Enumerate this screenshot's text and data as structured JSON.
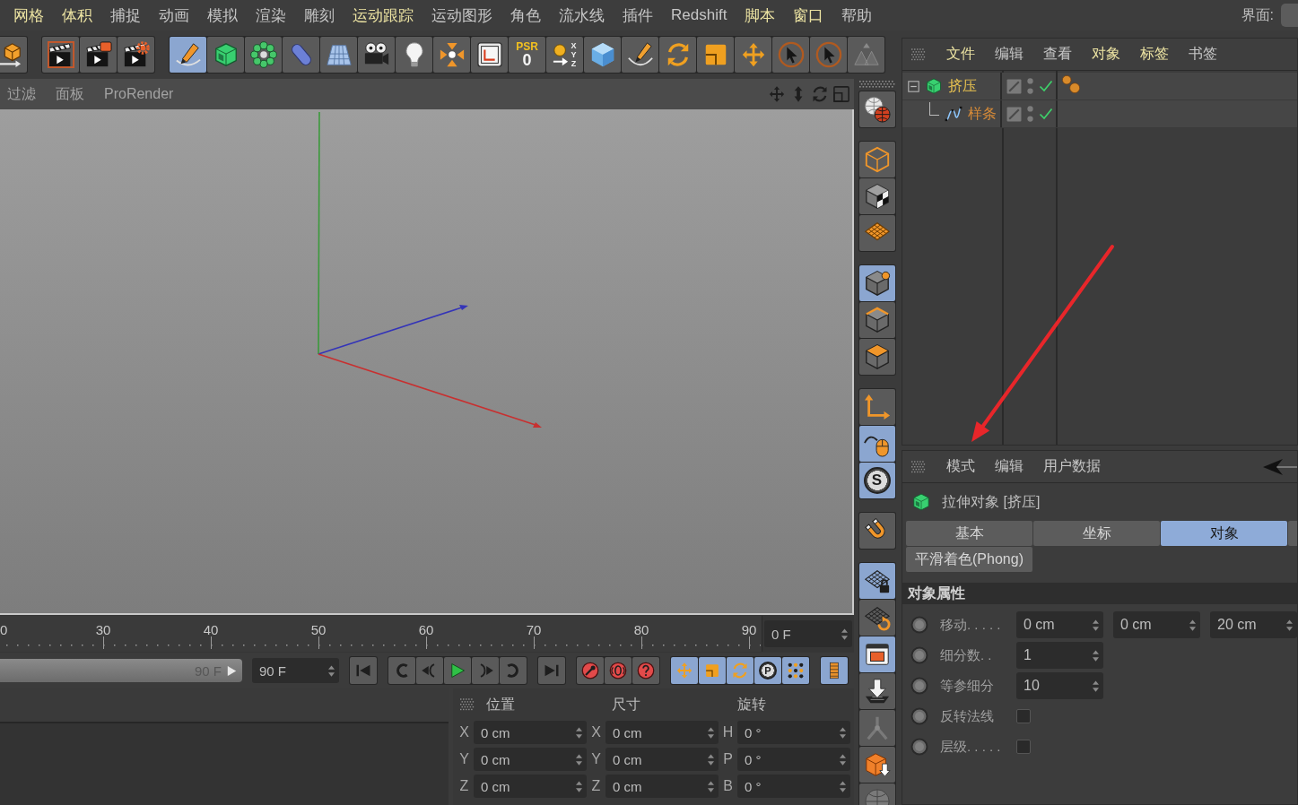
{
  "menu_bar": {
    "items": [
      {
        "label": "网格",
        "highlighted": true
      },
      {
        "label": "体积",
        "highlighted": true
      },
      {
        "label": "捕捉",
        "highlighted": false
      },
      {
        "label": "动画",
        "highlighted": false
      },
      {
        "label": "模拟",
        "highlighted": false
      },
      {
        "label": "渲染",
        "highlighted": false
      },
      {
        "label": "雕刻",
        "highlighted": false
      },
      {
        "label": "运动跟踪",
        "highlighted": true
      },
      {
        "label": "运动图形",
        "highlighted": false
      },
      {
        "label": "角色",
        "highlighted": false
      },
      {
        "label": "流水线",
        "highlighted": false
      },
      {
        "label": "插件",
        "highlighted": false
      },
      {
        "label": "Redshift",
        "highlighted": false
      },
      {
        "label": "脚本",
        "highlighted": true
      },
      {
        "label": "窗口",
        "highlighted": true
      },
      {
        "label": "帮助",
        "highlighted": false
      }
    ],
    "layout_label": "界面:"
  },
  "toolbar": {
    "groups": [
      {
        "buttons": [
          {
            "kind": "cube-arrow",
            "selected": false
          }
        ]
      },
      {
        "buttons": [
          {
            "kind": "render-view",
            "selected": false
          },
          {
            "kind": "render",
            "selected": false
          },
          {
            "kind": "render-settings",
            "selected": false
          }
        ]
      },
      {
        "buttons": [
          {
            "kind": "pen",
            "selected": true
          },
          {
            "kind": "extrude",
            "selected": false
          },
          {
            "kind": "cloner",
            "selected": false
          },
          {
            "kind": "capsule",
            "selected": false
          },
          {
            "kind": "floor",
            "selected": false
          },
          {
            "kind": "camera",
            "selected": false
          },
          {
            "kind": "light",
            "selected": false
          },
          {
            "kind": "effector",
            "selected": false
          },
          {
            "kind": "deformer",
            "selected": false
          },
          {
            "kind": "psr",
            "label": "PSR",
            "value": "0",
            "selected": false
          },
          {
            "kind": "axes",
            "letters": [
              "X",
              "Y",
              "Z"
            ],
            "selected": false
          },
          {
            "kind": "cube",
            "selected": false
          },
          {
            "kind": "spline-pen",
            "selected": false
          },
          {
            "kind": "rotate",
            "selected": false
          },
          {
            "kind": "scale",
            "selected": false
          },
          {
            "kind": "move",
            "selected": false
          },
          {
            "kind": "select",
            "selected": false
          },
          {
            "kind": "select",
            "selected": false
          },
          {
            "kind": "locked",
            "selected": false
          }
        ]
      }
    ]
  },
  "viewport": {
    "menu": [
      "过滤",
      "面板",
      "ProRender"
    ]
  },
  "side_toolbar": {
    "groups": [
      {
        "buttons": [
          {
            "kind": "render-globe",
            "selected": false
          }
        ]
      },
      {
        "buttons": [
          {
            "kind": "cube-outline",
            "selected": false
          },
          {
            "kind": "checker-cube",
            "selected": false
          },
          {
            "kind": "grid-plane",
            "selected": false
          }
        ]
      },
      {
        "buttons": [
          {
            "kind": "point-mode",
            "selected": true
          },
          {
            "kind": "edge-mode",
            "selected": false
          },
          {
            "kind": "polygon-mode",
            "selected": false
          }
        ]
      },
      {
        "buttons": [
          {
            "kind": "axis-mode",
            "selected": false
          },
          {
            "kind": "tweak",
            "selected": true
          },
          {
            "kind": "snap",
            "label": "S",
            "selected": true
          }
        ]
      },
      {
        "buttons": [
          {
            "kind": "magnet",
            "selected": false
          }
        ]
      },
      {
        "buttons": [
          {
            "kind": "grid-lock",
            "selected": true
          },
          {
            "kind": "grid-rotate",
            "selected": false
          },
          {
            "kind": "window",
            "selected": true
          },
          {
            "kind": "floor-arrow",
            "selected": false
          },
          {
            "kind": "joint",
            "selected": false
          },
          {
            "kind": "box-arrow",
            "selected": false
          },
          {
            "kind": "sphere",
            "selected": false
          }
        ]
      }
    ]
  },
  "timeline": {
    "ruler_labels": [
      "0",
      "30",
      "40",
      "50",
      "60",
      "70",
      "80",
      "90"
    ],
    "current_frame": "0 F",
    "preview_end": "90 F",
    "end_frame": "90 F",
    "transport_groups": [
      {
        "buttons": [
          {
            "kind": "go-start",
            "selected": false
          }
        ]
      },
      {
        "buttons": [
          {
            "kind": "prev-key",
            "selected": false
          },
          {
            "kind": "prev-frame",
            "selected": false
          },
          {
            "kind": "play",
            "selected": false
          },
          {
            "kind": "next-frame",
            "selected": false
          },
          {
            "kind": "next-key",
            "selected": false
          }
        ]
      },
      {
        "buttons": [
          {
            "kind": "go-end",
            "selected": false
          }
        ]
      },
      {
        "buttons": [
          {
            "kind": "record",
            "selected": false
          },
          {
            "kind": "autokey",
            "selected": false
          },
          {
            "kind": "keyframe-selection",
            "selected": false
          }
        ]
      },
      {
        "buttons": [
          {
            "kind": "key-position",
            "selected": true
          },
          {
            "kind": "key-scale",
            "selected": true
          },
          {
            "kind": "key-rotation",
            "selected": true
          },
          {
            "kind": "key-parameter",
            "label": "P",
            "selected": true
          },
          {
            "kind": "key-points",
            "selected": true
          }
        ]
      },
      {
        "buttons": [
          {
            "kind": "timeline",
            "selected": true
          }
        ]
      }
    ]
  },
  "coordinates": {
    "columns": [
      {
        "title": "位置",
        "fields": [
          {
            "axis": "X",
            "value": "0 cm"
          },
          {
            "axis": "Y",
            "value": "0 cm"
          },
          {
            "axis": "Z",
            "value": "0 cm"
          }
        ]
      },
      {
        "title": "尺寸",
        "fields": [
          {
            "axis": "X",
            "value": "0 cm"
          },
          {
            "axis": "Y",
            "value": "0 cm"
          },
          {
            "axis": "Z",
            "value": "0 cm"
          }
        ]
      },
      {
        "title": "旋转",
        "fields": [
          {
            "axis": "H",
            "value": "0 °"
          },
          {
            "axis": "P",
            "value": "0 °"
          },
          {
            "axis": "B",
            "value": "0 °"
          }
        ]
      }
    ]
  },
  "object_manager": {
    "menu": [
      {
        "label": "文件",
        "highlighted": true
      },
      {
        "label": "编辑",
        "highlighted": false
      },
      {
        "label": "查看",
        "highlighted": false
      },
      {
        "label": "对象",
        "highlighted": true
      },
      {
        "label": "标签",
        "highlighted": true
      },
      {
        "label": "书签",
        "highlighted": false
      }
    ],
    "objects": [
      {
        "name": "挤压",
        "kind": "extrude",
        "expanded": true,
        "selected": true,
        "active": true,
        "enabled": true,
        "tags": [
          {
            "kind": "phong"
          }
        ],
        "children": [
          {
            "name": "样条",
            "kind": "spline",
            "selected": true,
            "active": false,
            "enabled": true
          }
        ]
      }
    ]
  },
  "attributes": {
    "menu": [
      "模式",
      "编辑",
      "用户数据"
    ],
    "title": "拉伸对象 [挤压]",
    "tabs": [
      {
        "label": "基本",
        "selected": false
      },
      {
        "label": "坐标",
        "selected": false
      },
      {
        "label": "对象",
        "selected": true
      },
      {
        "label": "平滑着色(Phong)",
        "selected": false
      }
    ],
    "section": "对象属性",
    "properties": [
      {
        "kind": "vector",
        "label": "移动. . . . .",
        "values": [
          "0 cm",
          "0 cm",
          "20 cm"
        ]
      },
      {
        "kind": "number",
        "label": "细分数. .",
        "value": "1"
      },
      {
        "kind": "number",
        "label": "等参细分",
        "value": "10"
      },
      {
        "kind": "checkbox",
        "label": "反转法线",
        "checked": false
      },
      {
        "kind": "checkbox",
        "label": "层级. . . . .",
        "checked": false
      }
    ]
  }
}
